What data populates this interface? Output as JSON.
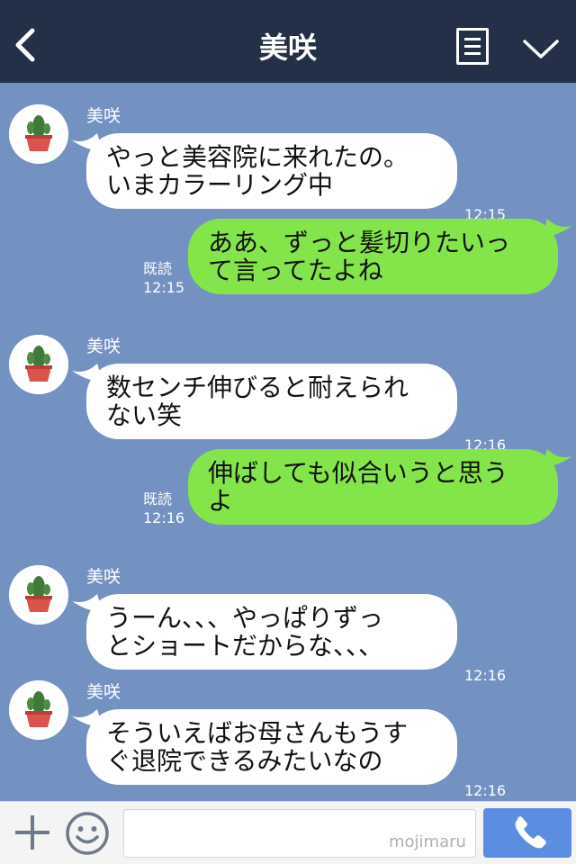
{
  "header": {
    "title": "美咲",
    "back_icon": "chevron-left-icon",
    "menu_icon": "menu-icon",
    "collapse_icon": "chevron-down-icon",
    "background": "#243047"
  },
  "chat": {
    "background": "#7391c1",
    "messages": [
      {
        "type": "incoming",
        "sender": "美咲",
        "lines": [
          "やっと美容院に来れたの。",
          "いまカラーリング中"
        ],
        "time": "12:15"
      },
      {
        "type": "outgoing",
        "lines": [
          "ああ、ずっと髪切りたいっ",
          "て言ってたよね"
        ],
        "read": "既読",
        "time": "12:15"
      },
      {
        "type": "incoming",
        "sender": "美咲",
        "lines": [
          "数センチ伸びると耐えられ",
          "ない笑"
        ],
        "time": "12:16"
      },
      {
        "type": "outgoing",
        "lines": [
          "伸ばしても似合いうと思う",
          "よ"
        ],
        "read": "既読",
        "time": "12:16"
      },
      {
        "type": "incoming",
        "sender": "美咲",
        "lines": [
          "うーん、、、やっぱりずっ",
          "とショートだからな、、、"
        ],
        "time": "12:16"
      },
      {
        "type": "incoming",
        "sender": "美咲",
        "lines": [
          "そういえばお母さんもうす",
          "ぐ退院できるみたいなの"
        ],
        "time": "12:16"
      }
    ],
    "incoming_bubble_color": "#ffffff",
    "outgoing_bubble_color": "#84e54b",
    "avatar_icon": "cactus-pot-icon"
  },
  "input_bar": {
    "plus_icon": "plus-icon",
    "emoji_icon": "smiley-icon",
    "watermark": "mojimaru",
    "call_icon": "phone-icon",
    "call_button_color": "#5b8ee0"
  }
}
